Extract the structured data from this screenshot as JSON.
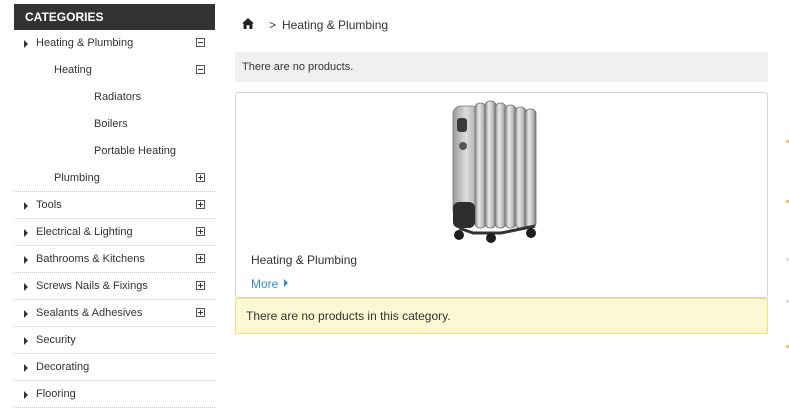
{
  "sidebar": {
    "title": "CATEGORIES",
    "items": [
      {
        "label": "Heating & Plumbing",
        "level": 0,
        "arrow": true,
        "toggle": "minus"
      },
      {
        "label": "Heating",
        "level": 1,
        "arrow": false,
        "toggle": "minus"
      },
      {
        "label": "Radiators",
        "level": 2,
        "arrow": false,
        "toggle": null
      },
      {
        "label": "Boilers",
        "level": 2,
        "arrow": false,
        "toggle": null
      },
      {
        "label": "Portable Heating",
        "level": 2,
        "arrow": false,
        "toggle": null
      },
      {
        "label": "Plumbing",
        "level": 1,
        "arrow": false,
        "toggle": "plus"
      },
      {
        "label": "Tools",
        "level": 0,
        "arrow": true,
        "toggle": "plus"
      },
      {
        "label": "Electrical & Lighting",
        "level": 0,
        "arrow": true,
        "toggle": "plus"
      },
      {
        "label": "Bathrooms & Kitchens",
        "level": 0,
        "arrow": true,
        "toggle": "plus"
      },
      {
        "label": "Screws Nails & Fixings",
        "level": 0,
        "arrow": true,
        "toggle": "plus"
      },
      {
        "label": "Sealants & Adhesives",
        "level": 0,
        "arrow": true,
        "toggle": "plus"
      },
      {
        "label": "Security",
        "level": 0,
        "arrow": true,
        "toggle": null
      },
      {
        "label": "Decorating",
        "level": 0,
        "arrow": true,
        "toggle": null
      },
      {
        "label": "Flooring",
        "level": 0,
        "arrow": true,
        "toggle": null
      }
    ]
  },
  "breadcrumb": {
    "home_icon": "home-icon",
    "separator": ">",
    "current": "Heating & Plumbing"
  },
  "main": {
    "no_products_notice": "There are no products.",
    "product": {
      "name": "Heating & Plumbing",
      "more_label": "More",
      "image_icon": "oil-radiator-heater-image"
    },
    "empty_category_notice": "There are no products in this category."
  },
  "colors": {
    "header_bg": "#333333",
    "link": "#2b8fd0",
    "notice_grey": "#f0f0f0",
    "notice_yellow": "#fcf8d4",
    "notice_yellow_border": "#ece280"
  }
}
